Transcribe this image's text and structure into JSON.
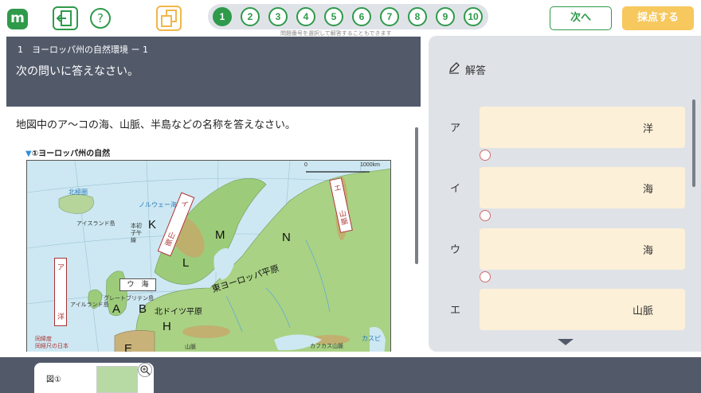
{
  "topbar": {
    "logo": "m",
    "help": "?",
    "question_numbers": [
      "1",
      "2",
      "3",
      "4",
      "5",
      "6",
      "7",
      "8",
      "9",
      "10"
    ],
    "active_question": "1",
    "nav_hint": "問題番号を選択して解答することもできます",
    "next_label": "次へ",
    "grade_label": "採点する"
  },
  "question": {
    "subtitle": "1　ヨーロッパ州の自然環境 ー 1",
    "title": "次の問いに答えなさい。",
    "text": "地図中のア〜コの海、山脈、半島などの名称を答えなさい。",
    "map_caption": "①ヨーロッパ州の自然",
    "map_labels": {
      "K": "K",
      "L": "L",
      "M": "M",
      "N": "N",
      "A": "A",
      "B": "B",
      "H": "H",
      "E": "E",
      "sea_u": "ウ　海",
      "ocean_a": "ア",
      "ocean_yo": "洋",
      "e_box": "エ",
      "e_box2": "山脈",
      "norway_sea": "ノルウェー海",
      "iceland": "アイスランド島",
      "arctic": "北極圏",
      "meridian": "本初子午線",
      "scandi": "山脈",
      "ireland": "アイルランド島",
      "gb": "グレートブリテン島",
      "plain_de": "北ドイツ平原",
      "plain_ee": "東ヨーロッパ平原",
      "caucasus": "カフカス山脈",
      "caspian": "カスピ",
      "scale": "1000km",
      "scale0": "0",
      "lat_note": "同緯度\n同経尺の日本",
      "alps": "山脈",
      "i_label": "イ"
    }
  },
  "answers": {
    "heading": "解答",
    "rows": [
      {
        "key": "ア",
        "suffix": "洋"
      },
      {
        "key": "イ",
        "suffix": "海"
      },
      {
        "key": "ウ",
        "suffix": "海"
      },
      {
        "key": "エ",
        "suffix": "山脈"
      }
    ]
  },
  "bottom": {
    "figure_tab": "図①"
  }
}
